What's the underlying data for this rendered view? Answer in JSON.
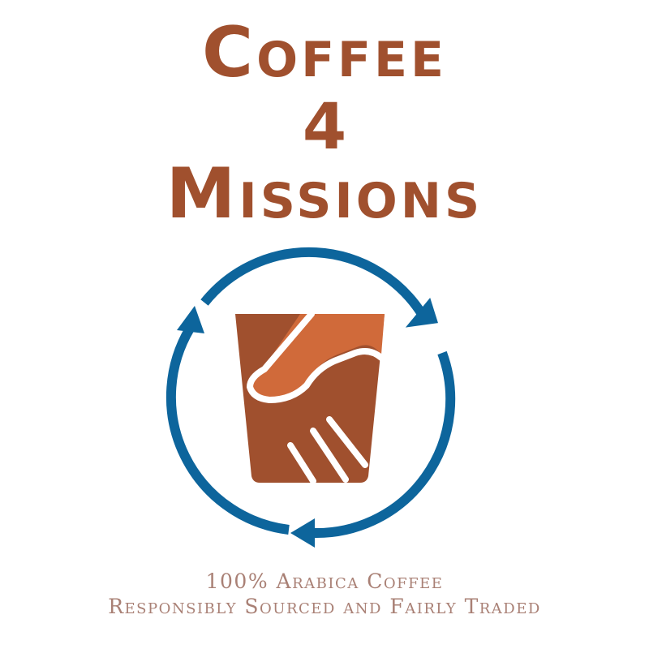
{
  "brand": {
    "title_line_1": "Coffee",
    "title_line_2": "4",
    "title_line_3": "Missions",
    "tagline_line_1": "100% Arabica Coffee",
    "tagline_line_2": "Responsibly Sourced and Fairly Traded"
  },
  "logo": {
    "icon": "coffee-cup-handshake-icon",
    "ring_icon": "circular-arrows-icon"
  },
  "colors": {
    "brand_brown": "#a0502e",
    "cup_orange": "#d06a3a",
    "ring_blue": "#0d659c",
    "tagline_taupe": "#a98075"
  }
}
